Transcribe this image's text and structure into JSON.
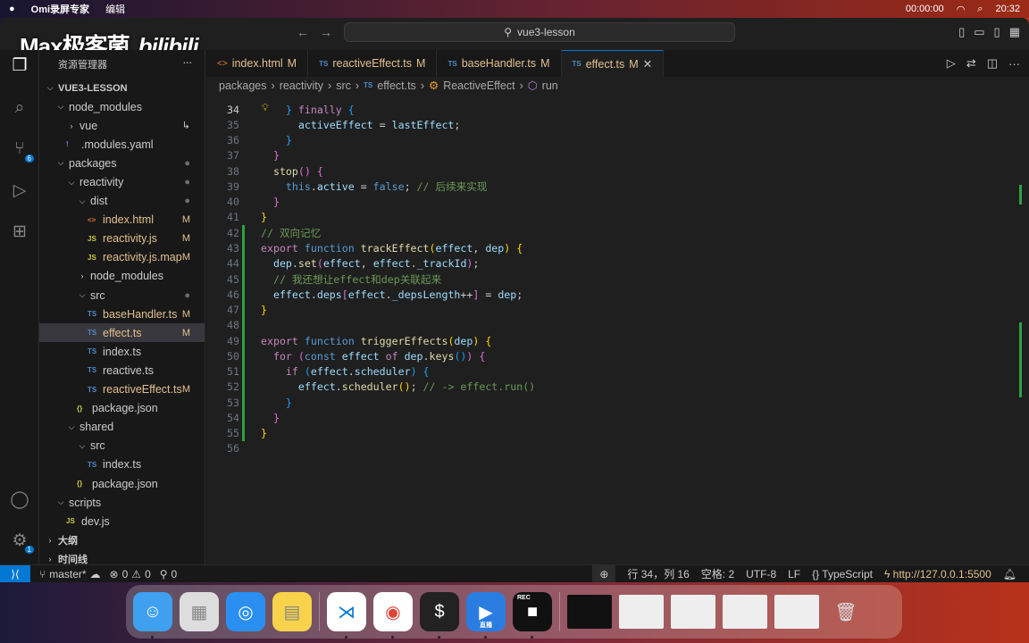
{
  "menubar": {
    "app": "Omi录屏专家",
    "menu": "编辑",
    "timer": "00:00:00",
    "clock": "20:32"
  },
  "titlebar": {
    "search": "vue3-lesson",
    "watermark": "Max极客菌",
    "watermark2": "bilibili"
  },
  "sidebar": {
    "title": "资源管理器",
    "more": "...",
    "tree": [
      {
        "label": "VUE3-LESSON",
        "depth": 0,
        "type": "folder",
        "open": true,
        "bold": true
      },
      {
        "label": "node_modules",
        "depth": 1,
        "type": "folder",
        "open": true
      },
      {
        "label": "vue",
        "depth": 2,
        "type": "folder",
        "open": false,
        "status": "↳"
      },
      {
        "label": ".modules.yaml",
        "depth": 2,
        "type": "yaml"
      },
      {
        "label": "packages",
        "depth": 1,
        "type": "folder",
        "open": true,
        "status": "●"
      },
      {
        "label": "reactivity",
        "depth": 2,
        "type": "folder",
        "open": true,
        "status": "●"
      },
      {
        "label": "dist",
        "depth": 3,
        "type": "folder",
        "open": true,
        "status": "●"
      },
      {
        "label": "index.html",
        "depth": 4,
        "type": "html",
        "status": "M"
      },
      {
        "label": "reactivity.js",
        "depth": 4,
        "type": "js",
        "status": "M"
      },
      {
        "label": "reactivity.js.map",
        "depth": 4,
        "type": "js",
        "status": "M"
      },
      {
        "label": "node_modules",
        "depth": 3,
        "type": "folder",
        "open": false
      },
      {
        "label": "src",
        "depth": 3,
        "type": "folder",
        "open": true,
        "status": "●"
      },
      {
        "label": "baseHandler.ts",
        "depth": 4,
        "type": "ts",
        "status": "M"
      },
      {
        "label": "effect.ts",
        "depth": 4,
        "type": "ts",
        "status": "M",
        "selected": true
      },
      {
        "label": "index.ts",
        "depth": 4,
        "type": "ts"
      },
      {
        "label": "reactive.ts",
        "depth": 4,
        "type": "ts"
      },
      {
        "label": "reactiveEffect.ts",
        "depth": 4,
        "type": "ts",
        "status": "M"
      },
      {
        "label": "package.json",
        "depth": 3,
        "type": "json"
      },
      {
        "label": "shared",
        "depth": 2,
        "type": "folder",
        "open": true
      },
      {
        "label": "src",
        "depth": 3,
        "type": "folder",
        "open": true
      },
      {
        "label": "index.ts",
        "depth": 4,
        "type": "ts"
      },
      {
        "label": "package.json",
        "depth": 3,
        "type": "json"
      },
      {
        "label": "scripts",
        "depth": 1,
        "type": "folder",
        "open": true
      },
      {
        "label": "dev.js",
        "depth": 2,
        "type": "js"
      },
      {
        "label": "大纲",
        "depth": 0,
        "type": "folder",
        "open": false,
        "bold": true
      },
      {
        "label": "时间线",
        "depth": 0,
        "type": "folder",
        "open": false,
        "bold": true
      }
    ]
  },
  "activity": {
    "scm_badge": "6",
    "settings_badge": "1"
  },
  "tabs": [
    {
      "label": "index.html",
      "status": "M",
      "type": "html"
    },
    {
      "label": "reactiveEffect.ts",
      "status": "M",
      "type": "ts"
    },
    {
      "label": "baseHandler.ts",
      "status": "M",
      "type": "ts"
    },
    {
      "label": "effect.ts",
      "status": "M",
      "type": "ts",
      "active": true
    }
  ],
  "breadcrumb": [
    "packages",
    "reactivity",
    "src",
    "effect.ts",
    "ReactiveEffect",
    "run"
  ],
  "code": {
    "current_line": 34,
    "lines": [
      {
        "n": 34,
        "t": [
          [
            "    ",
            ""
          ],
          [
            "}",
            "bl"
          ],
          [
            " finally ",
            "k"
          ],
          [
            "{",
            "bl"
          ]
        ]
      },
      {
        "n": 35,
        "t": [
          [
            "      ",
            ""
          ],
          [
            "activeEffect",
            "v"
          ],
          [
            " = ",
            ""
          ],
          [
            "lastEffect",
            "v"
          ],
          [
            ";",
            ""
          ]
        ]
      },
      {
        "n": 36,
        "t": [
          [
            "    ",
            ""
          ],
          [
            "}",
            "bl"
          ]
        ]
      },
      {
        "n": 37,
        "t": [
          [
            "  ",
            ""
          ],
          [
            "}",
            "p"
          ]
        ]
      },
      {
        "n": 38,
        "t": [
          [
            "  ",
            ""
          ],
          [
            "stop",
            "f"
          ],
          [
            "()",
            "p"
          ],
          [
            " ",
            ""
          ],
          [
            "{",
            "p"
          ]
        ]
      },
      {
        "n": 39,
        "t": [
          [
            "    ",
            ""
          ],
          [
            "this",
            "b"
          ],
          [
            ".",
            ""
          ],
          [
            "active",
            "v"
          ],
          [
            " = ",
            ""
          ],
          [
            "false",
            "b"
          ],
          [
            "; ",
            ""
          ],
          [
            "// 后续来实现",
            "c"
          ]
        ]
      },
      {
        "n": 40,
        "t": [
          [
            "  ",
            ""
          ],
          [
            "}",
            "p"
          ]
        ]
      },
      {
        "n": 41,
        "t": [
          [
            "}",
            "y"
          ]
        ]
      },
      {
        "n": 42,
        "t": [
          [
            "// 双向记忆",
            "c"
          ]
        ],
        "added": true
      },
      {
        "n": 43,
        "t": [
          [
            "export ",
            "k"
          ],
          [
            "function ",
            "b"
          ],
          [
            "trackEffect",
            "f"
          ],
          [
            "(",
            "y"
          ],
          [
            "effect",
            "v"
          ],
          [
            ", ",
            ""
          ],
          [
            "dep",
            "v"
          ],
          [
            ")",
            "y"
          ],
          [
            " ",
            ""
          ],
          [
            "{",
            "y"
          ]
        ],
        "added": true
      },
      {
        "n": 44,
        "t": [
          [
            "  ",
            ""
          ],
          [
            "dep",
            "v"
          ],
          [
            ".",
            ""
          ],
          [
            "set",
            "f"
          ],
          [
            "(",
            "p"
          ],
          [
            "effect",
            "v"
          ],
          [
            ", ",
            ""
          ],
          [
            "effect",
            "v"
          ],
          [
            ".",
            ""
          ],
          [
            "_trackId",
            "v"
          ],
          [
            ")",
            "p"
          ],
          [
            ";",
            ""
          ]
        ],
        "added": true
      },
      {
        "n": 45,
        "t": [
          [
            "  ",
            ""
          ],
          [
            "// 我还想让effect和dep关联起来",
            "c"
          ]
        ],
        "added": true
      },
      {
        "n": 46,
        "t": [
          [
            "  ",
            ""
          ],
          [
            "effect",
            "v"
          ],
          [
            ".",
            ""
          ],
          [
            "deps",
            "v"
          ],
          [
            "[",
            "p"
          ],
          [
            "effect",
            "v"
          ],
          [
            ".",
            ""
          ],
          [
            "_depsLength",
            "v"
          ],
          [
            "++",
            ""
          ],
          [
            "]",
            "p"
          ],
          [
            " = ",
            ""
          ],
          [
            "dep",
            "v"
          ],
          [
            ";",
            ""
          ]
        ],
        "added": true
      },
      {
        "n": 47,
        "t": [
          [
            "}",
            "y"
          ]
        ],
        "added": true
      },
      {
        "n": 48,
        "t": [],
        "added": true
      },
      {
        "n": 49,
        "t": [
          [
            "export ",
            "k"
          ],
          [
            "function ",
            "b"
          ],
          [
            "triggerEffects",
            "f"
          ],
          [
            "(",
            "y"
          ],
          [
            "dep",
            "v"
          ],
          [
            ")",
            "y"
          ],
          [
            " ",
            ""
          ],
          [
            "{",
            "y"
          ]
        ],
        "added": true
      },
      {
        "n": 50,
        "t": [
          [
            "  ",
            ""
          ],
          [
            "for ",
            "k"
          ],
          [
            "(",
            "p"
          ],
          [
            "const ",
            "b"
          ],
          [
            "effect",
            "v"
          ],
          [
            " of ",
            "k"
          ],
          [
            "dep",
            "v"
          ],
          [
            ".",
            ""
          ],
          [
            "keys",
            "f"
          ],
          [
            "()",
            "bl"
          ],
          [
            ")",
            "p"
          ],
          [
            " ",
            ""
          ],
          [
            "{",
            "p"
          ]
        ],
        "added": true
      },
      {
        "n": 51,
        "t": [
          [
            "    ",
            ""
          ],
          [
            "if ",
            "k"
          ],
          [
            "(",
            "bl"
          ],
          [
            "effect",
            "v"
          ],
          [
            ".",
            ""
          ],
          [
            "scheduler",
            "v"
          ],
          [
            ")",
            "bl"
          ],
          [
            " ",
            ""
          ],
          [
            "{",
            "bl"
          ]
        ],
        "added": true
      },
      {
        "n": 52,
        "t": [
          [
            "      ",
            ""
          ],
          [
            "effect",
            "v"
          ],
          [
            ".",
            ""
          ],
          [
            "scheduler",
            "f"
          ],
          [
            "()",
            "y"
          ],
          [
            "; ",
            ""
          ],
          [
            "// -> effect.run()",
            "c"
          ]
        ],
        "added": true
      },
      {
        "n": 53,
        "t": [
          [
            "    ",
            ""
          ],
          [
            "}",
            "bl"
          ]
        ],
        "added": true
      },
      {
        "n": 54,
        "t": [
          [
            "  ",
            ""
          ],
          [
            "}",
            "p"
          ]
        ],
        "added": true
      },
      {
        "n": 55,
        "t": [
          [
            "}",
            "y"
          ]
        ],
        "added": true
      },
      {
        "n": 56,
        "t": []
      }
    ]
  },
  "status": {
    "branch": "master*",
    "errors": "0",
    "warnings": "0",
    "ports": "0",
    "position": "行 34，列 16",
    "spaces": "空格: 2",
    "encoding": "UTF-8",
    "eol": "LF",
    "language": "TypeScript",
    "live": "http://127.0.0.1:5500"
  },
  "dock": [
    "Finder",
    "Launchpad",
    "Safari",
    "Notes",
    "Visual Studio Code",
    "Chrome",
    "Terminal",
    "直播",
    "REC"
  ],
  "colors": {
    "accent": "#0078d4",
    "added": "#2ea043",
    "modified": "#e2c08d"
  }
}
